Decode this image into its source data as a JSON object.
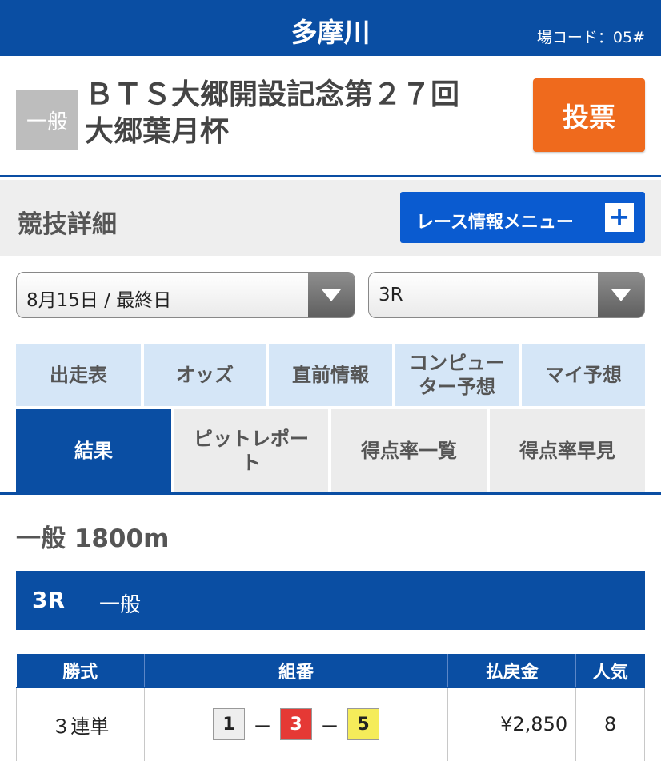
{
  "header": {
    "venue": "多摩川",
    "venue_code": "場コード：05#"
  },
  "race_info": {
    "grade": "一般",
    "title_line1": "ＢＴＳ大郷開設記念第２７回",
    "title_line2": "大郷葉月杯",
    "vote_label": "投票"
  },
  "detail": {
    "title": "競技詳細",
    "menu_label": "レース情報メニュー",
    "menu_icon": "plus-icon"
  },
  "selects": {
    "day": "8月15日 / 最終日",
    "race": "3R"
  },
  "tabs_row1": [
    {
      "label": "出走表"
    },
    {
      "label": "オッズ"
    },
    {
      "label": "直前情報"
    },
    {
      "label": "コンピュー\nター予想"
    },
    {
      "label": "マイ予想"
    }
  ],
  "tabs_row2": [
    {
      "label": "結果",
      "active": true
    },
    {
      "label": "ピットレポー\nト"
    },
    {
      "label": "得点率一覧"
    },
    {
      "label": "得点率早見"
    }
  ],
  "race": {
    "kind_distance": "一般 1800m",
    "number": "3R",
    "kind": "一般"
  },
  "result_table": {
    "headers": [
      "勝式",
      "組番",
      "払戻金",
      "人気"
    ],
    "rows": [
      {
        "type": "３連単",
        "combo": [
          {
            "num": "1",
            "bg": "#eeeeee",
            "color": "#222222"
          },
          {
            "num": "3",
            "bg": "#e53935",
            "color": "#ffffff"
          },
          {
            "num": "5",
            "bg": "#f5ec5a",
            "color": "#222222"
          }
        ],
        "dash": "－",
        "payout": "¥2,850",
        "popularity": "8"
      }
    ]
  },
  "colors": {
    "primary": "#0a4ea3",
    "accent": "#ef6a1d",
    "menu": "#0a5bd0"
  }
}
